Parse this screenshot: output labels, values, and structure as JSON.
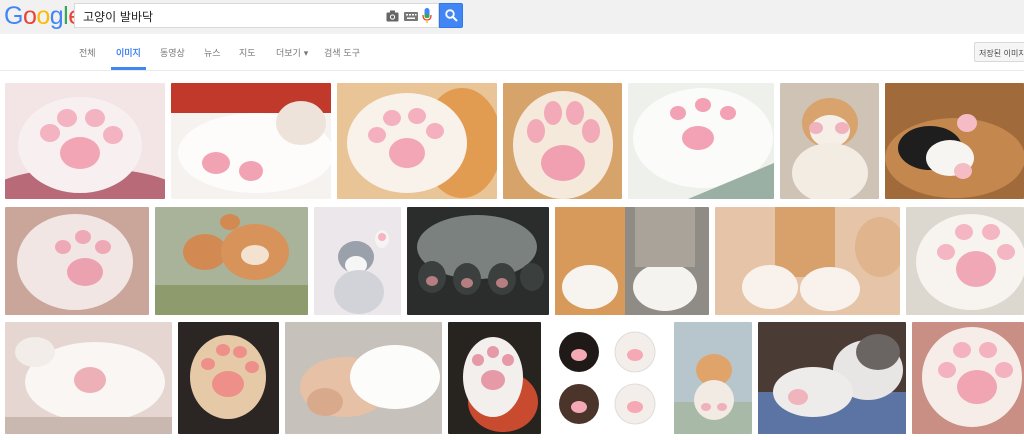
{
  "header": {
    "logo_letters": [
      "G",
      "o",
      "o",
      "g",
      "l",
      "e"
    ],
    "logo_colors": [
      "#4285f4",
      "#ea4335",
      "#fbbc05",
      "#4285f4",
      "#34a853",
      "#ea4335"
    ],
    "query": "고양이 발바닥",
    "icons": [
      "camera-icon",
      "keyboard-icon",
      "microphone-icon",
      "search-icon"
    ]
  },
  "tabs": [
    {
      "label": "전체"
    },
    {
      "label": "이미지"
    },
    {
      "label": "동영상"
    },
    {
      "label": "뉴스"
    },
    {
      "label": "지도"
    },
    {
      "label": "더보기 ▾"
    },
    {
      "label": "검색 도구"
    }
  ],
  "saved_button": "저장된 이미지",
  "colors": {
    "accent": "#4285f4",
    "topbar": "#f1f1f1"
  },
  "results": [
    {
      "row": 1,
      "theme": "pink toe beans close-up"
    },
    {
      "row": 1,
      "theme": "white cat lying with paws"
    },
    {
      "row": 1,
      "theme": "orange and white paw"
    },
    {
      "row": 1,
      "theme": "single pink paw pad"
    },
    {
      "row": 1,
      "theme": "fluffy white paw pads"
    },
    {
      "row": 1,
      "theme": "kitten holding paw to face"
    },
    {
      "row": 1,
      "theme": "black and white cat in basket"
    },
    {
      "row": 2,
      "theme": "white paw on pink"
    },
    {
      "row": 2,
      "theme": "cat bread loaves"
    },
    {
      "row": 2,
      "theme": "grey and white kitten waving"
    },
    {
      "row": 2,
      "theme": "grey cat paws on glass"
    },
    {
      "row": 2,
      "theme": "orange and grey paws"
    },
    {
      "row": 2,
      "theme": "white front paws on floor"
    },
    {
      "row": 2,
      "theme": "pink pads close-up"
    },
    {
      "row": 3,
      "theme": "white paw close-up"
    },
    {
      "row": 3,
      "theme": "pink paw on dark background"
    },
    {
      "row": 3,
      "theme": "hand holding white paw"
    },
    {
      "row": 3,
      "theme": "calico paw raised"
    },
    {
      "row": 3,
      "theme": "paw print illustrations"
    },
    {
      "row": 3,
      "theme": "kitten sitting in box"
    },
    {
      "row": 3,
      "theme": "grey and white cat with paws"
    },
    {
      "row": 3,
      "theme": "pink toe beans close-up"
    }
  ]
}
